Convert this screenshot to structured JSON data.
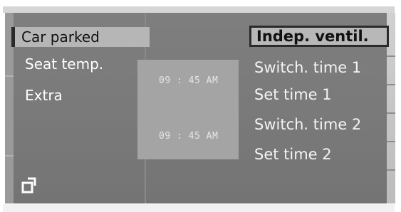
{
  "colors": {
    "screen_bg": "#7a7a7a",
    "highlight_bg": "#b6b6b6",
    "text": "#ffffff",
    "selected_text": "#111111",
    "time_box_bg": "#a4a4a4"
  },
  "left_menu": {
    "items": [
      {
        "label": "Car parked",
        "selected": true
      },
      {
        "label": "Seat temp.",
        "selected": false
      },
      {
        "label": "Extra",
        "selected": false
      }
    ]
  },
  "times": {
    "time1": "09 : 45 AM",
    "time2": "09 : 45 AM"
  },
  "right_menu": {
    "items": [
      {
        "label": "Indep. ventil.",
        "selected": true
      },
      {
        "label": "Switch. time 1",
        "selected": false
      },
      {
        "label": "Set time 1",
        "selected": false
      },
      {
        "label": "Switch. time 2",
        "selected": false
      },
      {
        "label": "Set time 2",
        "selected": false
      }
    ]
  },
  "icons": {
    "corner": "return-icon"
  }
}
